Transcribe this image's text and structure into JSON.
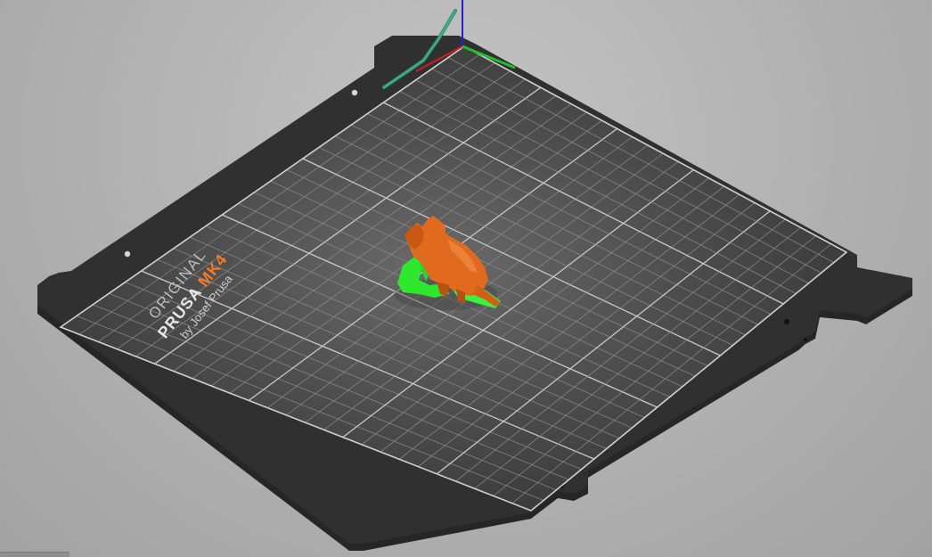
{
  "scene": {
    "view": "3D print bed preview",
    "background_color": "#b6b6b6",
    "bed": {
      "sheet_color": "#2e2e2e",
      "surface_color": "#3a3a3a",
      "grid_color": "#8c8c8c",
      "major_grid_color": "#c8c8c8",
      "grid_major_divisions": 5,
      "grid_minor_per_major": 5,
      "logo": {
        "line1": "ORIGINAL",
        "line2_part1": "PRUSA ",
        "line2_part2": "MK4",
        "line3": "by Josef Prusa",
        "accent_color": "#f07b2a"
      }
    },
    "axes": {
      "x_color": "#d21e1e",
      "y_color": "#1fbf2c",
      "z_color": "#2020d0"
    },
    "model": {
      "name": "dinosaur-figure",
      "color": "#e06b1e",
      "support_color": "#2ee82e"
    }
  }
}
